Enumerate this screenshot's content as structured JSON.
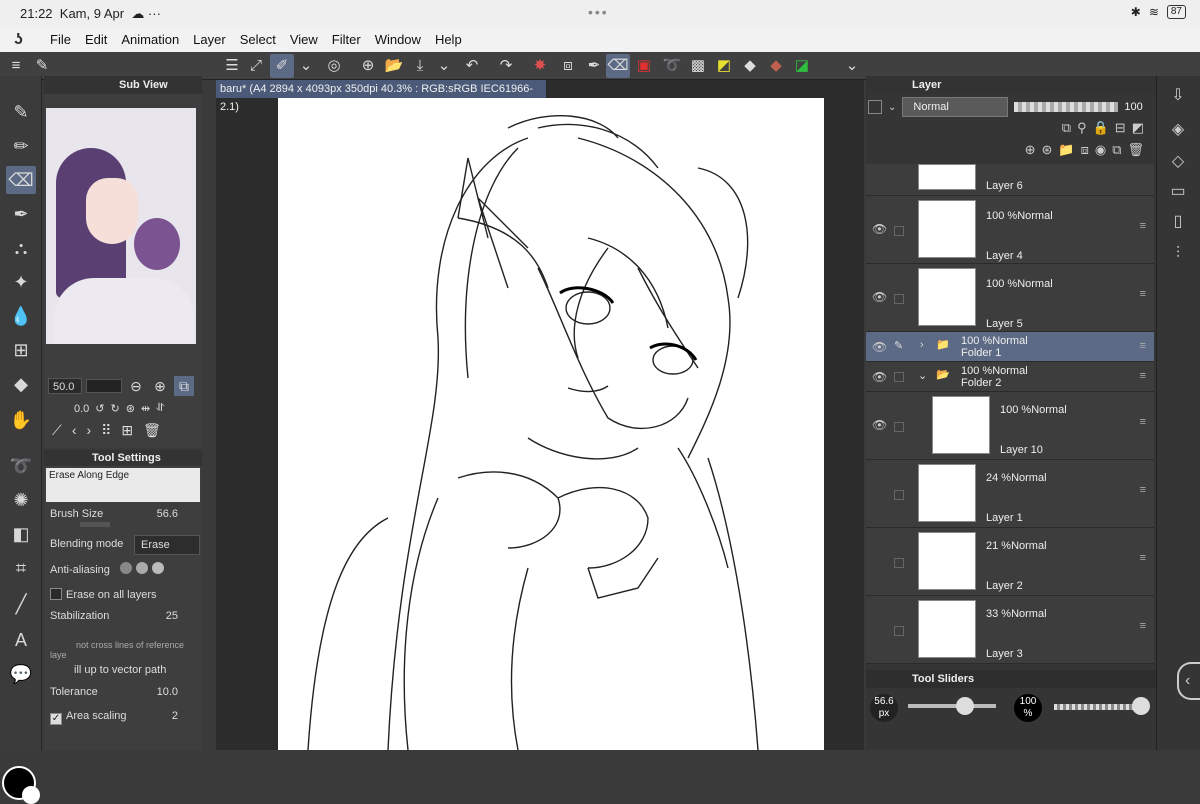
{
  "status": {
    "time": "21:22",
    "date": "Kam, 9 Apr",
    "battery": "87"
  },
  "menu": {
    "items": [
      "File",
      "Edit",
      "Animation",
      "Layer",
      "Select",
      "View",
      "Filter",
      "Window",
      "Help"
    ]
  },
  "subview": {
    "title": "Sub View",
    "zoom": "50.0",
    "rotation": "0.0"
  },
  "tool_settings": {
    "title": "Tool Settings",
    "preset": "Erase Along Edge",
    "brush_size_label": "Brush Size",
    "brush_size_value": "56.6",
    "blending_label": "Blending mode",
    "blending_value": "Erase",
    "antialias_label": "Anti-aliasing",
    "erase_all_label": "Erase on all layers",
    "stabilization_label": "Stabilization",
    "stabilization_value": "25",
    "cross_lines_label": "not cross lines of reference laye",
    "vector_path_label": "ill up to vector path",
    "tolerance_label": "Tolerance",
    "tolerance_value": "10.0",
    "area_scaling_label": "Area scaling",
    "area_scaling_value": "2"
  },
  "canvas": {
    "tab": "baru* (A4 2894 x 4093px 350dpi 40.3% : RGB:sRGB IEC61966-2.1)"
  },
  "layer_panel": {
    "title": "Layer",
    "blend_mode": "Normal",
    "opacity": "100",
    "layers": [
      {
        "name": "Layer 6",
        "mode": "",
        "selected": false
      },
      {
        "name": "Layer 4",
        "mode": "100 %Normal",
        "selected": false
      },
      {
        "name": "Layer 5",
        "mode": "100 %Normal",
        "selected": false
      },
      {
        "name": "Folder 1",
        "mode": "100 %Normal",
        "selected": true
      },
      {
        "name": "Folder 2",
        "mode": "100 %Normal",
        "selected": false
      },
      {
        "name": "Layer 10",
        "mode": "100 %Normal",
        "selected": false
      },
      {
        "name": "Layer 1",
        "mode": "24 %Normal",
        "selected": false
      },
      {
        "name": "Layer 2",
        "mode": "21 %Normal",
        "selected": false
      },
      {
        "name": "Layer 3",
        "mode": "33 %Normal",
        "selected": false
      }
    ]
  },
  "tool_sliders": {
    "title": "Tool Sliders",
    "size": "56.6",
    "size_unit": "px",
    "opacity": "100",
    "opacity_unit": "%"
  }
}
